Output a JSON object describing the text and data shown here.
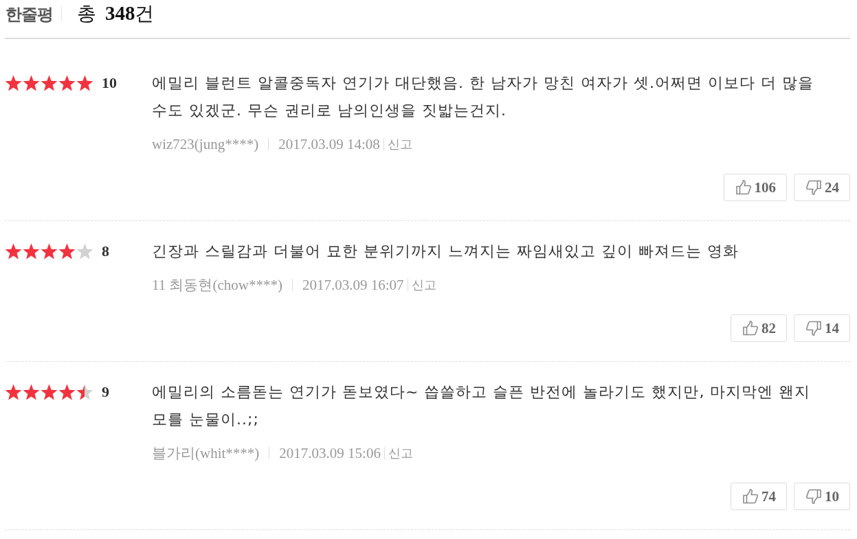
{
  "header": {
    "title": "한줄평",
    "total": "총 **348**건"
  },
  "reviews": [
    {
      "stars": 5,
      "score": "10",
      "text": "에밀리 블런트 알콜중독자 연기가 대단했음. 한 남자가 망친 여자가 셋.어쩌면 이보다 더 많을 수도 있겠군. 무슨 권리로 남의인생을 짓밟는건지.",
      "author": "wiz723(jung****)",
      "date": "2017.03.09 14:08",
      "report": "신고",
      "likes": "106",
      "dislikes": "24"
    },
    {
      "stars": 4,
      "score": "8",
      "text": "긴장과 스릴감과 더불어 묘한 분위기까지 느껴지는 짜임새있고 깊이 빠져드는 영화",
      "author": "11 최동현(chow****)",
      "date": "2017.03.09 16:07",
      "report": "신고",
      "likes": "82",
      "dislikes": "14"
    },
    {
      "stars": 4.5,
      "score": "9",
      "text": "에밀리의 소름돋는 연기가 돋보였다~ 씁쓸하고 슬픈 반전에 놀라기도 했지만, 마지막엔 왠지 모를 눈물이..;;",
      "author": "블가리(whit****)",
      "date": "2017.03.09 15:06",
      "report": "신고",
      "likes": "74",
      "dislikes": "10"
    }
  ]
}
